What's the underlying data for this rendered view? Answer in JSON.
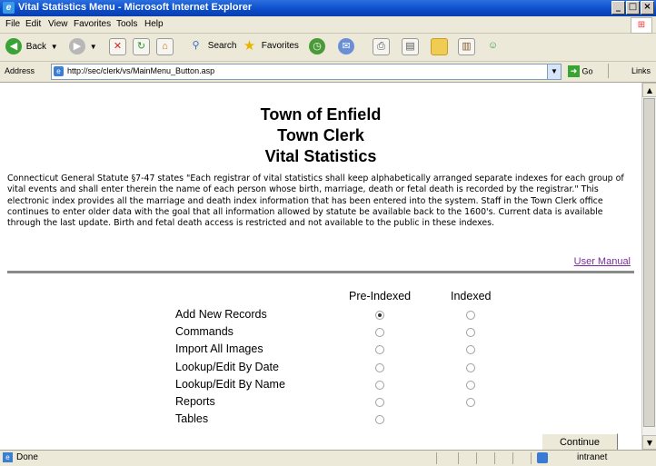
{
  "window": {
    "title": "Vital Statistics Menu - Microsoft Internet Explorer"
  },
  "menu": [
    "File",
    "Edit",
    "View",
    "Favorites",
    "Tools",
    "Help"
  ],
  "toolbar": {
    "back": "Back",
    "search": "Search",
    "favorites": "Favorites"
  },
  "address": {
    "label": "Address",
    "url": "http://sec/clerk/vs/MainMenu_Button.asp",
    "go": "Go",
    "links": "Links"
  },
  "page": {
    "heading1": "Town of Enfield",
    "heading2": "Town Clerk",
    "heading3": "Vital Statistics",
    "description": "Connecticut General Statute §7-47 states \"Each registrar of vital statistics shall keep alphabetically arranged separate indexes for each group of vital events and shall enter therein the name of each person whose birth, marriage, death or fetal death is recorded by the registrar.\" This electronic index provides all the marriage and death index information that has been entered into the system. Staff in the Town Clerk office continues to enter older data with the goal that all information allowed by statute be available back to the 1600's. Current data is available through the last update. Birth and fetal death access is restricted and not available to the public in these indexes.",
    "user_manual": "User Manual",
    "col_preindexed": "Pre-Indexed",
    "col_indexed": "Indexed",
    "continue": "Continue",
    "options": [
      {
        "label": "Add New Records",
        "pre": true,
        "pre_selected": true,
        "idx": true
      },
      {
        "label": "Commands",
        "pre": true,
        "pre_selected": false,
        "idx": true
      },
      {
        "label": "Import All Images",
        "pre": true,
        "pre_selected": false,
        "idx": true
      },
      {
        "label": "Lookup/Edit By Date",
        "pre": true,
        "pre_selected": false,
        "idx": true
      },
      {
        "label": "Lookup/Edit By Name",
        "pre": true,
        "pre_selected": false,
        "idx": true
      },
      {
        "label": "Reports",
        "pre": true,
        "pre_selected": false,
        "idx": true
      },
      {
        "label": "Tables",
        "pre": true,
        "pre_selected": false,
        "idx": false
      }
    ]
  },
  "status": {
    "left": "Done",
    "zone": "intranet"
  }
}
